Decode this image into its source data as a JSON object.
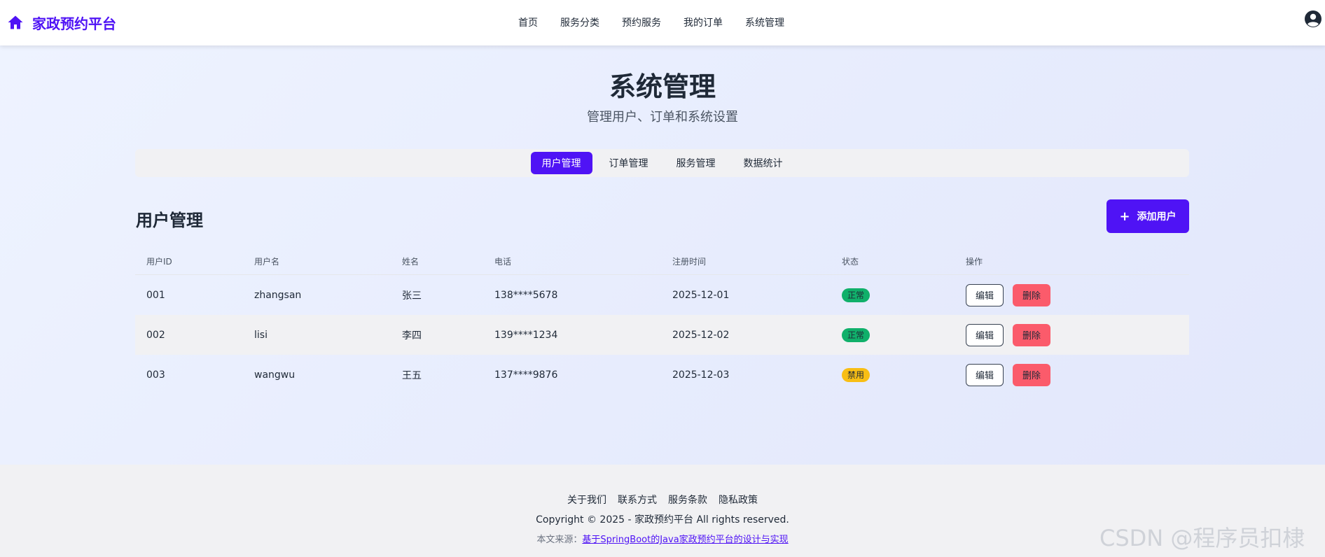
{
  "header": {
    "brand": "家政预约平台",
    "nav": [
      "首页",
      "服务分类",
      "预约服务",
      "我的订单",
      "系统管理"
    ]
  },
  "page": {
    "title": "系统管理",
    "subtitle": "管理用户、订单和系统设置"
  },
  "tabs": [
    {
      "label": "用户管理",
      "active": true
    },
    {
      "label": "订单管理",
      "active": false
    },
    {
      "label": "服务管理",
      "active": false
    },
    {
      "label": "数据统计",
      "active": false
    }
  ],
  "section": {
    "title": "用户管理",
    "add_button": "添加用户"
  },
  "table": {
    "columns": [
      "用户ID",
      "用户名",
      "姓名",
      "电话",
      "注册时间",
      "状态",
      "操作"
    ],
    "rows": [
      {
        "id": "001",
        "username": "zhangsan",
        "name": "张三",
        "phone": "138****5678",
        "registered": "2025-12-01",
        "status": "正常",
        "status_type": "ok",
        "edit": "编辑",
        "delete": "删除"
      },
      {
        "id": "002",
        "username": "lisi",
        "name": "李四",
        "phone": "139****1234",
        "registered": "2025-12-02",
        "status": "正常",
        "status_type": "ok",
        "edit": "编辑",
        "delete": "删除"
      },
      {
        "id": "003",
        "username": "wangwu",
        "name": "王五",
        "phone": "137****9876",
        "registered": "2025-12-03",
        "status": "禁用",
        "status_type": "off",
        "edit": "编辑",
        "delete": "删除"
      }
    ]
  },
  "footer": {
    "links": [
      "关于我们",
      "联系方式",
      "服务条款",
      "隐私政策"
    ],
    "copyright": "Copyright © 2025 - 家政预约平台 All rights reserved.",
    "source_prefix": "本文来源：",
    "source_link": "基于SpringBoot的Java家政预约平台的设计与实现",
    "watermark": "CSDN @程序员扣棣"
  },
  "colors": {
    "accent": "#4f13f5",
    "status_ok": "#10b06a",
    "status_off": "#f8be14",
    "danger": "#fb5b6b"
  },
  "icons": {
    "home": "home-icon",
    "user": "user-avatar-icon",
    "add": "plus-icon"
  }
}
